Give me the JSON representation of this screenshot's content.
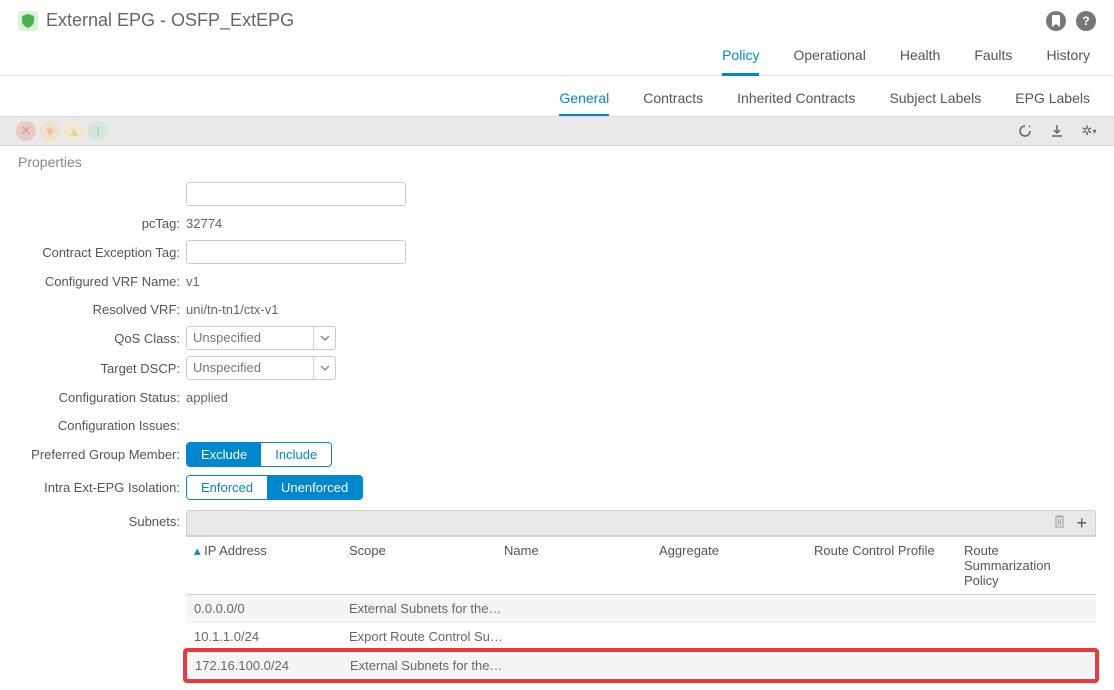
{
  "title": "External EPG - OSFP_ExtEPG",
  "primaryTabs": [
    "Policy",
    "Operational",
    "Health",
    "Faults",
    "History"
  ],
  "primaryActive": "Policy",
  "secondaryTabs": [
    "General",
    "Contracts",
    "Inherited Contracts",
    "Subject Labels",
    "EPG Labels"
  ],
  "secondaryActive": "General",
  "propertiesLabel": "Properties",
  "form": {
    "pcTag": {
      "label": "pcTag:",
      "value": "32774"
    },
    "contractExceptionTag": {
      "label": "Contract Exception Tag:",
      "value": ""
    },
    "configuredVrfName": {
      "label": "Configured VRF Name:",
      "value": "v1"
    },
    "resolvedVrf": {
      "label": "Resolved VRF:",
      "value": "uni/tn-tn1/ctx-v1"
    },
    "qosClass": {
      "label": "QoS Class:",
      "value": "Unspecified"
    },
    "targetDscp": {
      "label": "Target DSCP:",
      "value": "Unspecified"
    },
    "configStatus": {
      "label": "Configuration Status:",
      "value": "applied"
    },
    "configIssues": {
      "label": "Configuration Issues:",
      "value": ""
    },
    "preferredGroup": {
      "label": "Preferred Group Member:",
      "options": [
        "Exclude",
        "Include"
      ],
      "active": "Exclude"
    },
    "isolation": {
      "label": "Intra Ext-EPG Isolation:",
      "options": [
        "Enforced",
        "Unenforced"
      ],
      "active": "Unenforced"
    },
    "subnetsLabel": "Subnets:"
  },
  "subnets": {
    "columns": [
      "IP Address",
      "Scope",
      "Name",
      "Aggregate",
      "Route Control Profile",
      "Route Summarization Policy"
    ],
    "rows": [
      {
        "ip": "0.0.0.0/0",
        "scope": "External Subnets for the E..."
      },
      {
        "ip": "10.1.1.0/24",
        "scope": "Export Route Control Subnet"
      },
      {
        "ip": "172.16.100.0/24",
        "scope": "External Subnets for the E..."
      }
    ]
  }
}
